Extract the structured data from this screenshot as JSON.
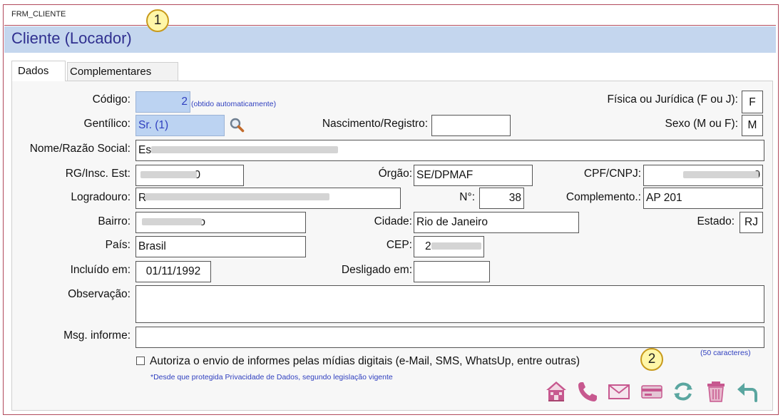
{
  "form": {
    "name": "FRM_CLIENTE",
    "title": "Cliente (Locador)"
  },
  "callouts": [
    "1",
    "2"
  ],
  "tabs": [
    {
      "label": "Dados",
      "active": true
    },
    {
      "label": "Complementares",
      "active": false
    }
  ],
  "fields": {
    "codigo": {
      "label": "Código:",
      "value": "2",
      "hint": "(obtido automaticamente)"
    },
    "fisica_juridica": {
      "label": "Física ou Jurídica (F ou J):",
      "value": "F"
    },
    "gentilico": {
      "label": "Gentílico:",
      "value": "Sr. (1)"
    },
    "nascimento": {
      "label": "Nascimento/Registro:",
      "value": ""
    },
    "sexo": {
      "label": "Sexo (M ou F):",
      "value": "M"
    },
    "nome": {
      "label": "Nome/Razão Social:",
      "value": "Es"
    },
    "rg": {
      "label": "RG/Insc. Est:",
      "value": "0"
    },
    "orgao": {
      "label": "Órgão:",
      "value": "SE/DPMAF"
    },
    "cpf": {
      "label": "CPF/CNPJ:",
      "value": "0"
    },
    "logradouro": {
      "label": "Logradouro:",
      "value": "R"
    },
    "numero": {
      "label": "N°:",
      "value": "38"
    },
    "complemento": {
      "label": "Complemento.:",
      "value": "AP 201"
    },
    "bairro": {
      "label": "Bairro:",
      "value": "o"
    },
    "cidade": {
      "label": "Cidade:",
      "value": "Rio de Janeiro"
    },
    "estado": {
      "label": "Estado:",
      "value": "RJ"
    },
    "pais": {
      "label": "País:",
      "value": "Brasil"
    },
    "cep": {
      "label": "CEP:",
      "value": "2"
    },
    "incluido": {
      "label": "Incluído em:",
      "value": "01/11/1992"
    },
    "desligado": {
      "label": "Desligado em:",
      "value": ""
    },
    "observacao": {
      "label": "Observação:",
      "value": ""
    },
    "msg_informe": {
      "label": "Msg. informe:",
      "value": "",
      "hint": "(50 caracteres)"
    }
  },
  "consent": {
    "label": "Autoriza o envio de informes pelas mídias digitais (e-Mail, SMS, WhatsUp, entre outras)",
    "checked": false,
    "note": "*Desde que protegida Privacidade de Dados, segundo legislação vigente"
  },
  "toolbar": [
    "house-icon",
    "phone-icon",
    "envelope-icon",
    "card-icon",
    "refresh-icon",
    "trash-icon",
    "undo-icon"
  ],
  "colors": {
    "title_bar": "#c4d6ee",
    "title_text": "#2f2f8f",
    "frame_border": "#b14a5c",
    "readonly_field": "#bcd3f2",
    "icon_pink": "#c7588f",
    "icon_teal": "#5aa6a0"
  }
}
